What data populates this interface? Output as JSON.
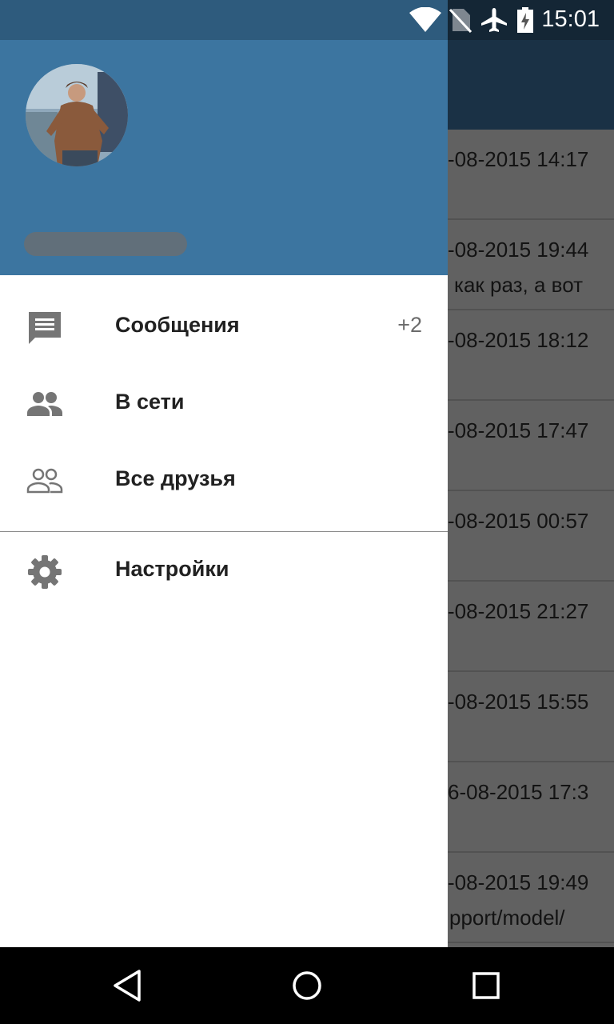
{
  "status_bar": {
    "time": "15:01",
    "icons": [
      "wifi-icon",
      "no-sim-icon",
      "airplane-mode-icon",
      "battery-charging-icon"
    ]
  },
  "background_list": {
    "rows": [
      {
        "date": "-08-2015 14:17",
        "preview": ""
      },
      {
        "date": "-08-2015 19:44",
        "preview": "как раз, а вот"
      },
      {
        "date": "-08-2015 18:12",
        "preview": ""
      },
      {
        "date": "-08-2015 17:47",
        "preview": ""
      },
      {
        "date": "-08-2015 00:57",
        "preview": ""
      },
      {
        "date": "-08-2015 21:27",
        "preview": ""
      },
      {
        "date": "-08-2015 15:55",
        "preview": ""
      },
      {
        "date": "6-08-2015 17:3",
        "preview": ""
      },
      {
        "date": "-08-2015 19:49",
        "preview": "pport/model/"
      }
    ]
  },
  "drawer": {
    "header": {
      "avatar": "user-avatar-photo",
      "user_name": ""
    },
    "menu": [
      {
        "label": "Сообщения",
        "icon": "message-icon",
        "badge": "+2"
      },
      {
        "label": "В сети",
        "icon": "people-online-icon",
        "badge": ""
      },
      {
        "label": "Все друзья",
        "icon": "all-friends-icon",
        "badge": ""
      }
    ],
    "settings": {
      "label": "Настройки",
      "icon": "settings-gear-icon"
    }
  },
  "nav_bar": {
    "buttons": [
      "back-icon",
      "home-icon",
      "recents-icon"
    ]
  },
  "colors": {
    "drawer_header": "#3c75a0",
    "toolbar": "#2e5577",
    "icon_gray": "#757575"
  }
}
